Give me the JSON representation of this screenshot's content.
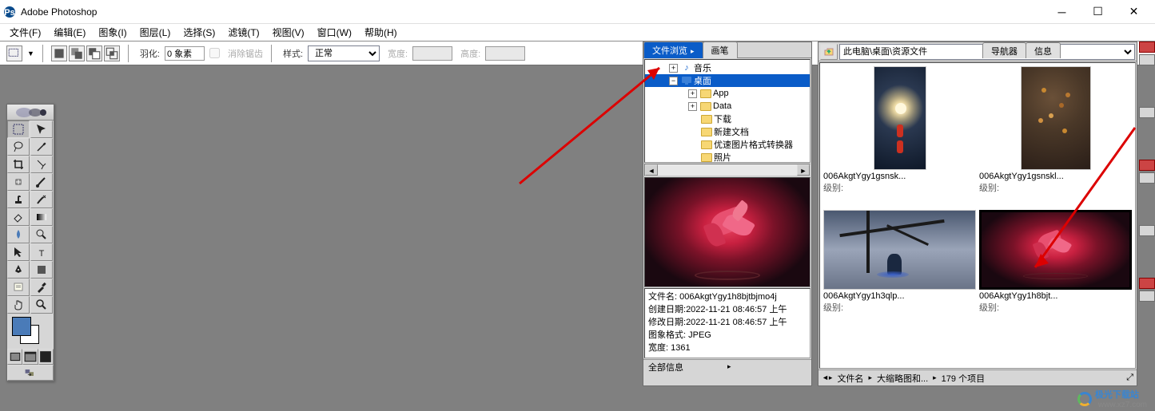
{
  "app": {
    "title": "Adobe Photoshop"
  },
  "menu": {
    "file": "文件(F)",
    "edit": "编辑(E)",
    "image": "图象(I)",
    "layer": "图层(L)",
    "select": "选择(S)",
    "filter": "滤镜(T)",
    "view": "视图(V)",
    "window": "窗口(W)",
    "help": "帮助(H)"
  },
  "options": {
    "feather_label": "羽化:",
    "feather_value": "0 象素",
    "antialias": "消除锯齿",
    "style_label": "样式:",
    "style_value": "正常",
    "width_label": "宽度:",
    "height_label": "高度:"
  },
  "panel_tabs": {
    "file_browser": "文件浏览",
    "brushes": "画笔",
    "navigator": "导航器",
    "info": "信息"
  },
  "tree": {
    "music": "音乐",
    "desktop": "桌面",
    "app": "App",
    "data": "Data",
    "downloads": "下载",
    "newdoc": "新建文档",
    "converter": "优速图片格式转换器",
    "photos": "照片"
  },
  "metadata": {
    "filename_label": "文件名:",
    "filename": "006AkgtYgy1h8bjtbjmo4j",
    "created_label": "创建日期:",
    "created": "2022-11-21 08:46:57 上午",
    "modified_label": "修改日期:",
    "modified": "2022-11-21 08:46:57 上午",
    "format_label": "图象格式:",
    "format": "JPEG",
    "width_label": "宽度:",
    "width": "1361"
  },
  "panel_footer": {
    "all_info": "全部信息"
  },
  "thumb_path": "此电脑\\桌面\\资源文件",
  "thumbs": [
    {
      "name": "006AkgtYgy1gsnsk...",
      "rank_label": "级别:"
    },
    {
      "name": "006AkgtYgy1gsnskl...",
      "rank_label": "级别:"
    },
    {
      "name": "006AkgtYgy1h3qlp...",
      "rank_label": "级别:"
    },
    {
      "name": "006AkgtYgy1h8bjt...",
      "rank_label": "级别:"
    }
  ],
  "thumb_footer": {
    "sort_by": "文件名",
    "view_mode": "大缩略图和...",
    "count": "179 个项目"
  },
  "watermark": {
    "name": "极光下载站",
    "url": "www.xz7.com"
  }
}
